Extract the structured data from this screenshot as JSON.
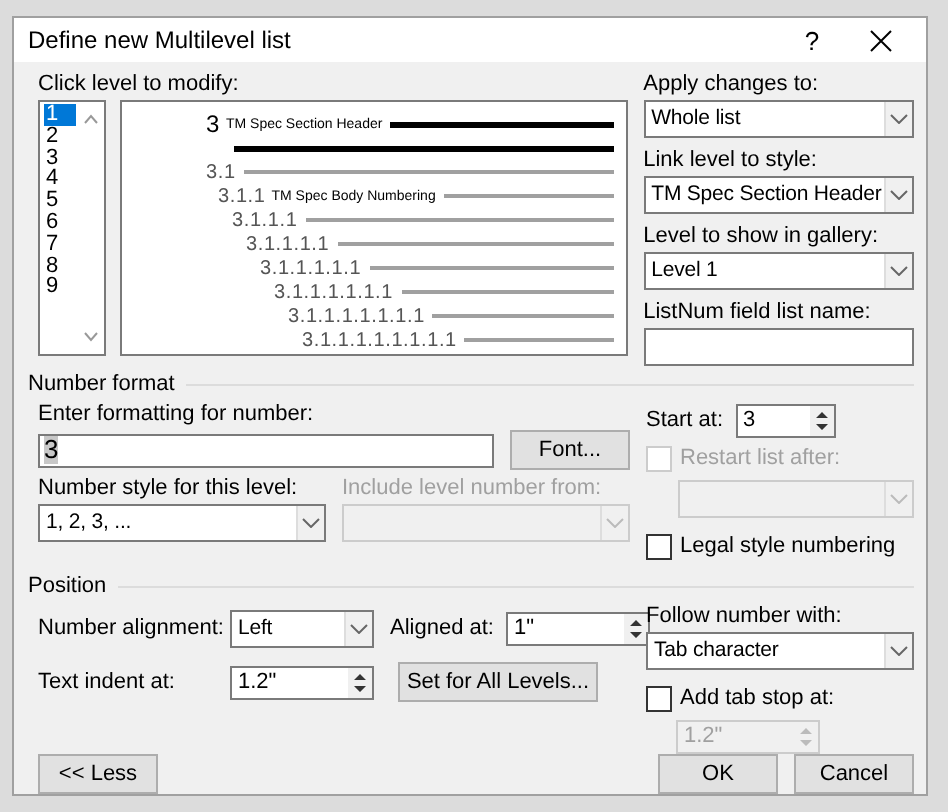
{
  "window": {
    "title": "Define new Multilevel list",
    "help_label": "?"
  },
  "levels": {
    "label": "Click level to modify:",
    "items": [
      {
        "label": "1",
        "selected": true
      },
      {
        "label": "2",
        "selected": false
      },
      {
        "label": "3",
        "selected": false
      },
      {
        "label": "4",
        "selected": false
      },
      {
        "label": "5",
        "selected": false
      },
      {
        "label": "6",
        "selected": false
      },
      {
        "label": "7",
        "selected": false
      },
      {
        "label": "8",
        "selected": false
      },
      {
        "label": "9",
        "selected": false
      }
    ]
  },
  "preview": [
    {
      "number": "3",
      "style": "TM Spec Section Header",
      "kind": "heading"
    },
    {
      "number": "3.1",
      "kind": "plain"
    },
    {
      "number": "3.1.1",
      "style": "TM Spec Body Numbering",
      "kind": "plain"
    },
    {
      "number": "3.1.1.1",
      "kind": "plain"
    },
    {
      "number": "3.1.1.1.1",
      "kind": "plain"
    },
    {
      "number": "3.1.1.1.1.1",
      "kind": "plain"
    },
    {
      "number": "3.1.1.1.1.1.1",
      "kind": "plain"
    },
    {
      "number": "3.1.1.1.1.1.1.1",
      "kind": "plain"
    },
    {
      "number": "3.1.1.1.1.1.1.1.1",
      "kind": "plain"
    }
  ],
  "apply_changes": {
    "label": "Apply changes to:",
    "value": "Whole list"
  },
  "link_level": {
    "label": "Link level to style:",
    "value": "TM Spec Section Header"
  },
  "gallery_level": {
    "label": "Level to show in gallery:",
    "value": "Level 1"
  },
  "listnum": {
    "label": "ListNum field list name:"
  },
  "number_format": {
    "title": "Number format",
    "format_label": "Enter formatting for number:",
    "format_value": "3",
    "font_button": "Font...",
    "style_label": "Number style for this level:",
    "style_value": "1, 2, 3, ...",
    "include_label": "Include level number from:",
    "include_disabled": true,
    "start_label": "Start at:",
    "start_value": "3",
    "restart": {
      "label": "Restart list after:",
      "checked": false,
      "disabled": true
    },
    "legal": {
      "label": "Legal style numbering",
      "checked": false,
      "disabled": false
    }
  },
  "position": {
    "title": "Position",
    "alignment_label": "Number alignment:",
    "alignment_value": "Left",
    "aligned_at_label": "Aligned at:",
    "aligned_at_value": "1\"",
    "indent_label": "Text indent at:",
    "indent_value": "1.2\"",
    "set_all_button": "Set for All Levels...",
    "follow_label": "Follow number with:",
    "follow_value": "Tab character",
    "tab_stop": {
      "label": "Add tab stop at:",
      "checked": false,
      "disabled": false
    },
    "tab_stop_value": "1.2\"",
    "tab_stop_disabled": true
  },
  "buttons": {
    "less": "<< Less",
    "ok": "OK",
    "cancel": "Cancel"
  }
}
